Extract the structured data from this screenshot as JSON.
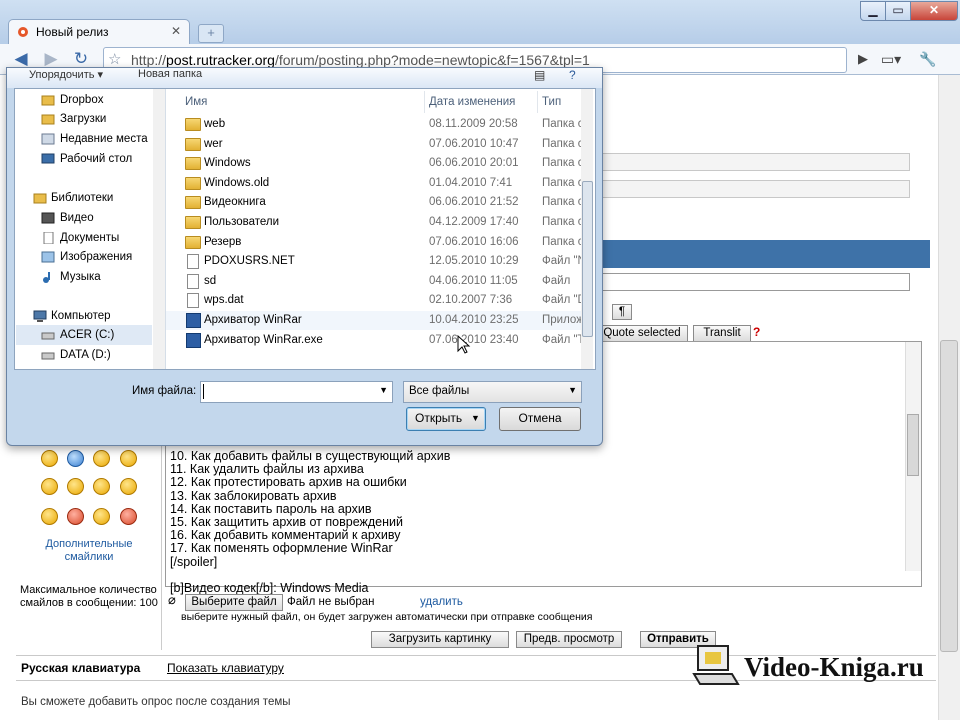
{
  "browser": {
    "tab_title": "Новый релиз",
    "url_host": "post.rutracker.org",
    "url_path": "/forum/posting.php?mode=newtopic&f=1567&tpl=1"
  },
  "dialog": {
    "toolbar_organize": "Упорядочить ▾",
    "toolbar_new_folder": "Новая папка",
    "nav": [
      {
        "label": "Dropbox"
      },
      {
        "label": "Загрузки"
      },
      {
        "label": "Недавние места"
      },
      {
        "label": "Рабочий стол"
      },
      {
        "label": "Библиотеки"
      },
      {
        "label": "Видео"
      },
      {
        "label": "Документы"
      },
      {
        "label": "Изображения"
      },
      {
        "label": "Музыка"
      },
      {
        "label": "Компьютер"
      },
      {
        "label": "ACER (C:)"
      },
      {
        "label": "DATA (D:)"
      }
    ],
    "columns": {
      "name": "Имя",
      "date": "Дата изменения",
      "type": "Тип"
    },
    "files": [
      {
        "name": "web",
        "date": "08.11.2009 20:58",
        "type": "Папка с ф",
        "icon": "folder"
      },
      {
        "name": "wer",
        "date": "07.06.2010 10:47",
        "type": "Папка с ф",
        "icon": "folder"
      },
      {
        "name": "Windows",
        "date": "06.06.2010 20:01",
        "type": "Папка с ф",
        "icon": "folder"
      },
      {
        "name": "Windows.old",
        "date": "01.04.2010 7:41",
        "type": "Папка с ф",
        "icon": "folder"
      },
      {
        "name": "Видеокнига",
        "date": "06.06.2010 21:52",
        "type": "Папка с ф",
        "icon": "folder"
      },
      {
        "name": "Пользователи",
        "date": "04.12.2009 17:40",
        "type": "Папка с ф",
        "icon": "folder"
      },
      {
        "name": "Резерв",
        "date": "07.06.2010 16:06",
        "type": "Папка с ф",
        "icon": "folder"
      },
      {
        "name": "PDOXUSRS.NET",
        "date": "12.05.2010 10:29",
        "type": "Файл \"NE",
        "icon": "file"
      },
      {
        "name": "sd",
        "date": "04.06.2010 11:05",
        "type": "Файл",
        "icon": "file"
      },
      {
        "name": "wps.dat",
        "date": "02.10.2007 7:36",
        "type": "Файл \"DA",
        "icon": "file"
      },
      {
        "name": "Архиватор WinRar",
        "date": "10.04.2010 23:25",
        "type": "Приложе",
        "icon": "app"
      },
      {
        "name": "Архиватор WinRar.exe",
        "date": "07.06.2010 23:40",
        "type": "Файл \"TO",
        "icon": "app"
      }
    ],
    "filename_label": "Имя файла:",
    "filename_value": "",
    "filter_value": "Все файлы",
    "open_label": "Открыть",
    "cancel_label": "Отмена"
  },
  "page": {
    "quote_selected": "Quote selected",
    "translit": "Translit",
    "help": "?",
    "pilcrow": "¶",
    "editor_text": "10. Как добавить файлы в существующий архив\n11. Как удалить файлы из архива\n12. Как протестировать архив на ошибки\n13. Как заблокировать архив\n14. Как поставить пароль на архив\n15. Как защитить архив от повреждений\n16. Как добавить комментарий к архиву\n17. Как поменять оформление WinRar\n[/spoiler]\n\n[b]Видео кодек[/b]: Windows Media",
    "more_smilies": "Дополнительные смайлики",
    "max_smilies": "Максимальное количество смайлов в сообщении: 100",
    "choose_file": "Выберите файл",
    "no_file": "Файл не выбран",
    "delete": "удалить",
    "upload_hint": "выберите нужный файл, он будет загружен автоматически при отправке сообщения",
    "upload_picture": "Загрузить картинку",
    "preview": "Предв. просмотр",
    "submit": "Отправить",
    "russian_keyboard": "Русская клавиатура",
    "show_keyboard": "Показать клавиатуру",
    "poll_note": "Вы сможете добавить опрос после создания темы"
  },
  "watermark": "Video-Kniga.ru"
}
